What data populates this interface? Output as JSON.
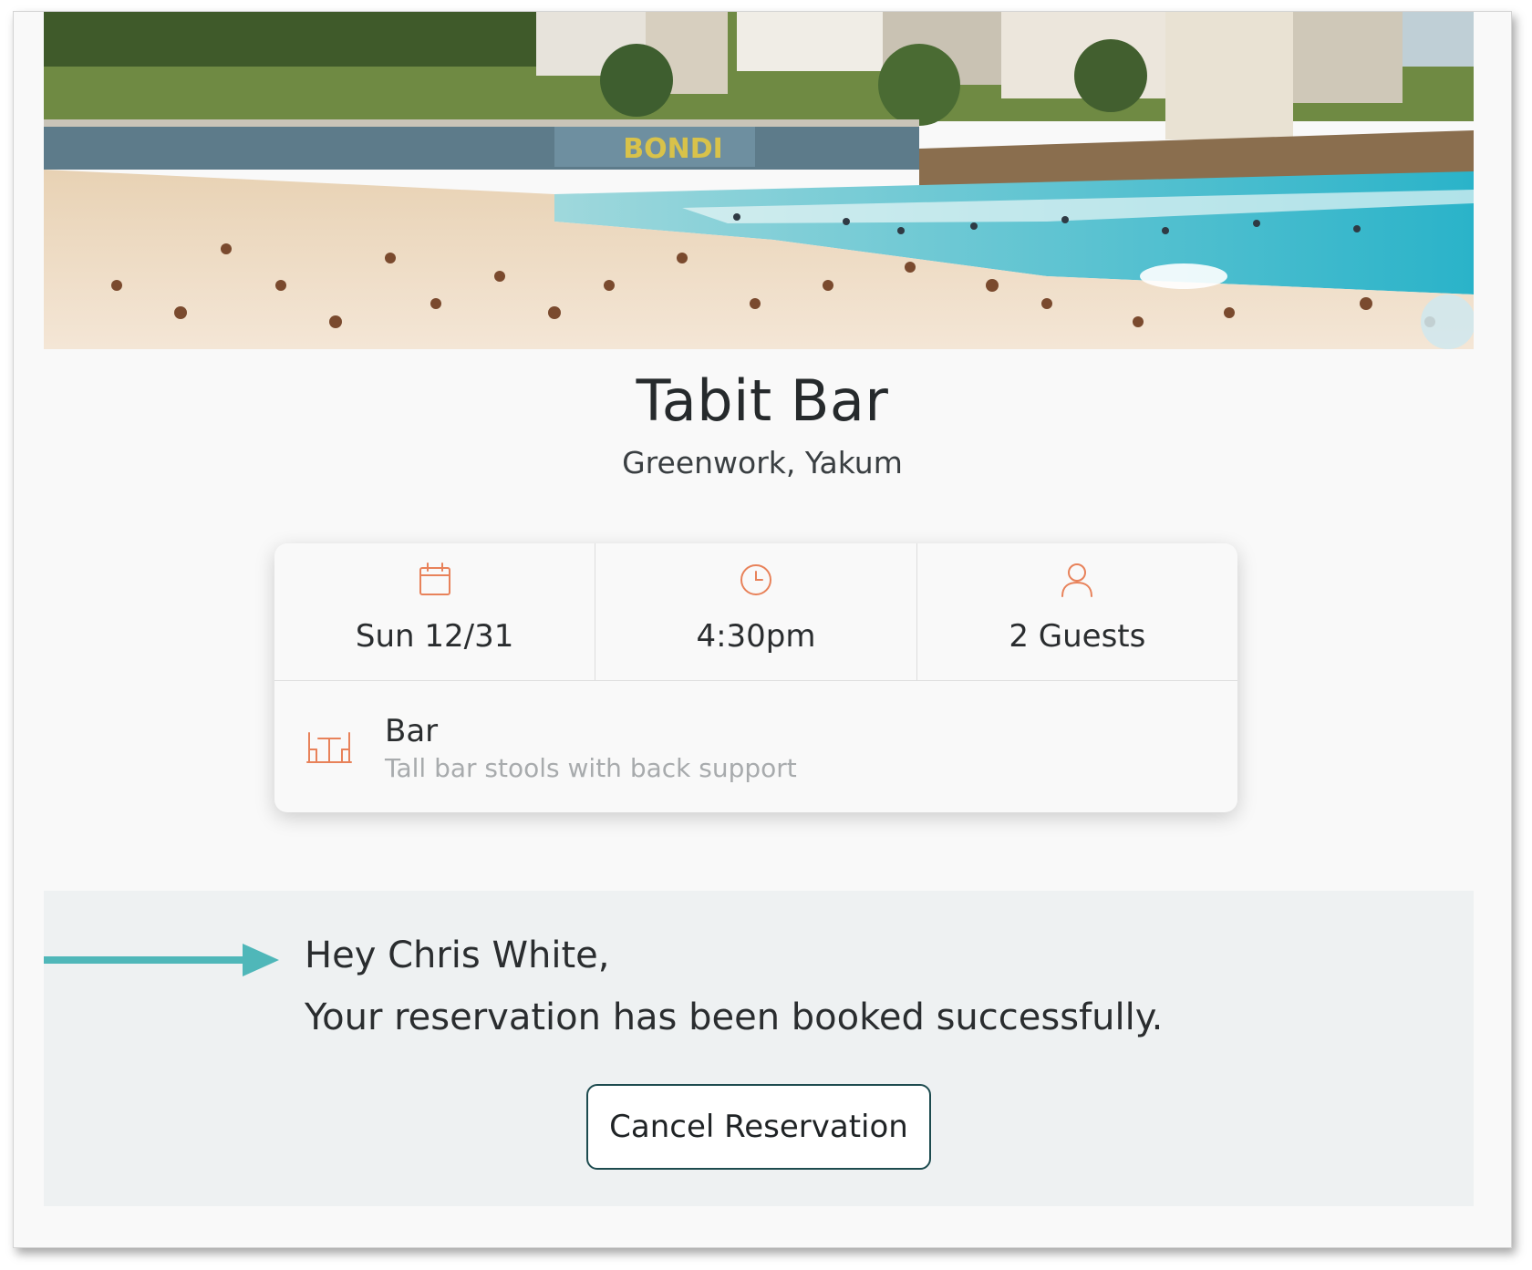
{
  "venue": {
    "name": "Tabit Bar",
    "location": "Greenwork, Yakum"
  },
  "reservation": {
    "date": "Sun 12/31",
    "time": "4:30pm",
    "guests": "2 Guests",
    "seating": {
      "name": "Bar",
      "description": "Tall bar stools with back support"
    }
  },
  "confirmation": {
    "greeting": "Hey Chris White,",
    "message": "Your reservation has been booked successfully.",
    "cancel_label": "Cancel Reservation"
  },
  "hero_sign_text": "BONDI",
  "colors": {
    "accent": "#e8825a",
    "arrow": "#4fb7b9",
    "button_border": "#1d4b4f",
    "panel_background": "#eef1f2"
  },
  "icons": [
    "calendar-icon",
    "clock-icon",
    "person-icon",
    "bar-table-icon",
    "arrow-right-icon"
  ]
}
